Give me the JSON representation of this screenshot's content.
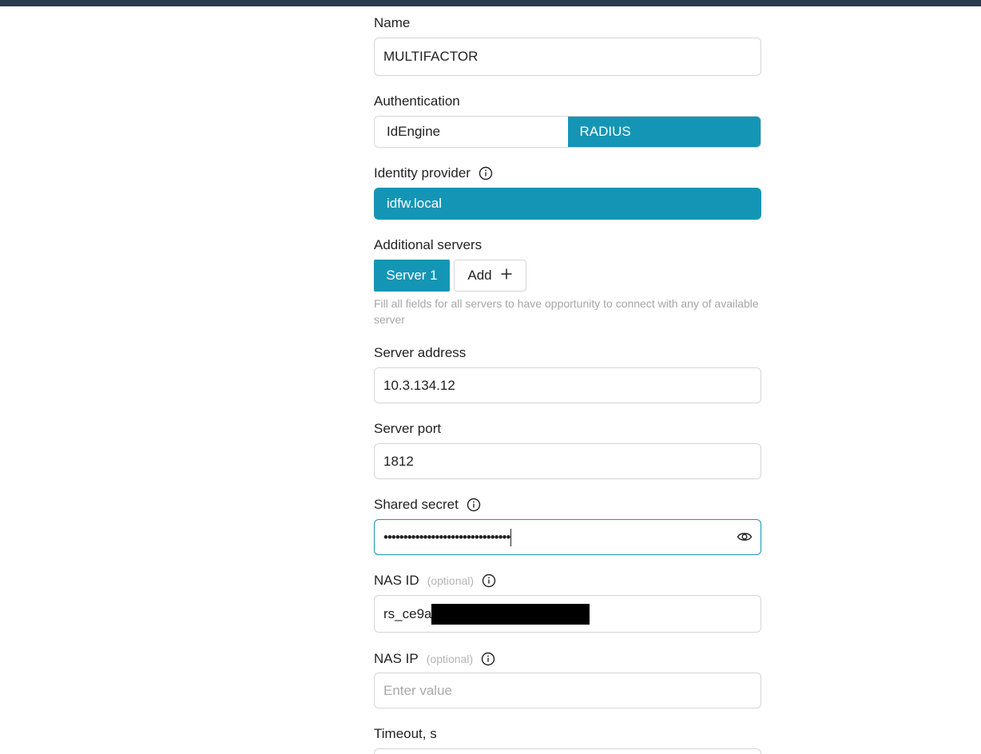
{
  "form": {
    "name": {
      "label": "Name",
      "value": "MULTIFACTOR"
    },
    "authentication": {
      "label": "Authentication",
      "options": [
        "IdEngine",
        "RADIUS"
      ],
      "selected": "RADIUS"
    },
    "identity_provider": {
      "label": "Identity provider",
      "value": "idfw.local"
    },
    "additional_servers": {
      "label": "Additional servers",
      "tabs": [
        "Server 1"
      ],
      "add_label": "Add",
      "hint": "Fill all fields for all servers to have opportunity to connect with any of available server"
    },
    "server_address": {
      "label": "Server address",
      "value": "10.3.134.12"
    },
    "server_port": {
      "label": "Server port",
      "value": "1812"
    },
    "shared_secret": {
      "label": "Shared secret",
      "value": "••••••••••••••••••••••••••••••••"
    },
    "nas_id": {
      "label": "NAS ID",
      "optional": "(optional)",
      "value": "rs_ce9a"
    },
    "nas_ip": {
      "label": "NAS IP",
      "optional": "(optional)",
      "placeholder": "Enter value"
    },
    "timeout": {
      "label": "Timeout, s"
    }
  },
  "colors": {
    "accent": "#1595b5",
    "topbar": "#2b3a4c",
    "border": "#d6d6d6"
  }
}
